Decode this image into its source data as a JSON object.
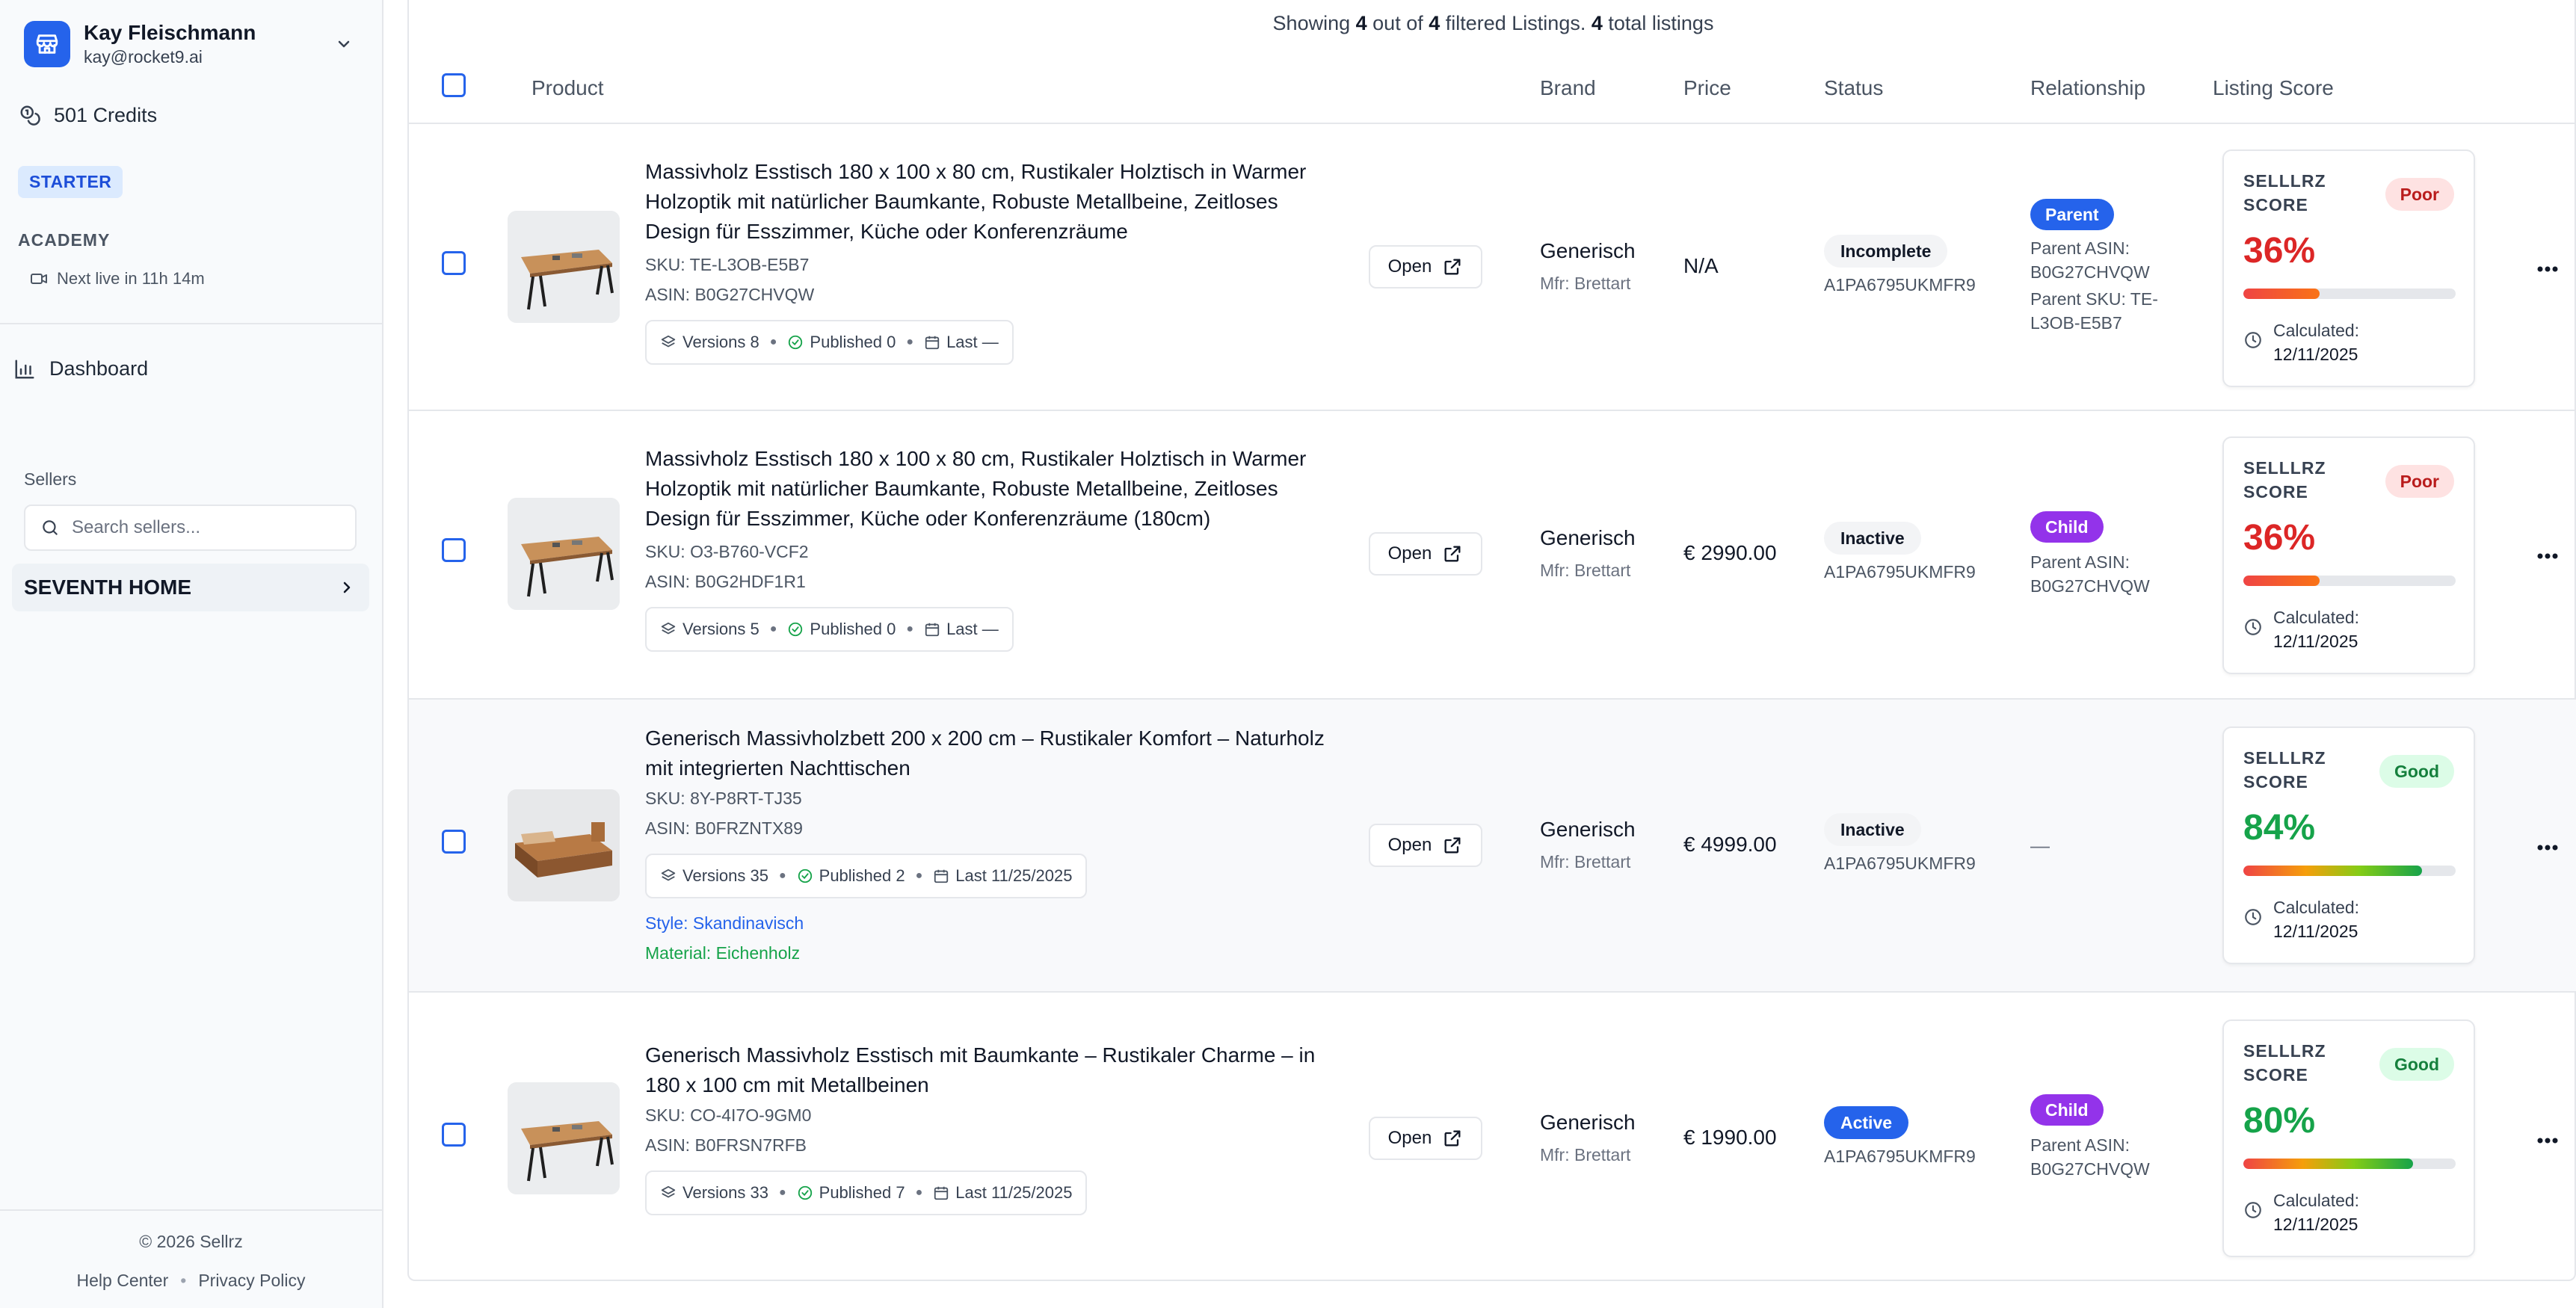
{
  "account": {
    "name": "Kay Fleischmann",
    "email": "kay@rocket9.ai"
  },
  "credits": "501 Credits",
  "plan": "STARTER",
  "academy": {
    "label": "ACADEMY",
    "next_live": "Next live in 11h 14m"
  },
  "nav": {
    "dashboard": "Dashboard"
  },
  "sellers": {
    "label": "Sellers",
    "search_placeholder": "Search sellers...",
    "items": [
      {
        "name": "SEVENTH HOME"
      }
    ]
  },
  "footer": {
    "copyright": "© 2026 Sellrz",
    "help": "Help Center",
    "privacy": "Privacy Policy",
    "separator": "•"
  },
  "summary": {
    "prefix": "Showing ",
    "shown": "4",
    "middle": " out of ",
    "filtered": "4",
    "middle2": " filtered Listings. ",
    "total": "4",
    "suffix": " total listings"
  },
  "columns": {
    "product": "Product",
    "brand": "Brand",
    "price": "Price",
    "status": "Status",
    "relationship": "Relationship",
    "score": "Listing Score"
  },
  "open_label": "Open",
  "score_title": "SELLLRZ SCORE",
  "calc_label": "Calculated:",
  "rows": [
    {
      "title": "Massivholz Esstisch 180 x 100 x 80 cm, Rustikaler Holztisch in Warmer Holzoptik mit natürlicher Baumkante, Robuste Metallbeine, Zeitloses Design für Esszimmer, Küche oder Konferenzräume",
      "sku": "SKU: TE-L3OB-E5B7",
      "asin": "ASIN: B0G27CHVQW",
      "versions": "Versions 8",
      "published": "Published 0",
      "last": "Last —",
      "brand": "Generisch",
      "mfr": "Mfr: Brettart",
      "price": "N/A",
      "status": "Incomplete",
      "seller_id": "A1PA6795UKMFR9",
      "rel": "Parent",
      "rel_info_1": "Parent ASIN: B0G27CHVQW",
      "rel_info_2": "Parent SKU: TE-L3OB-E5B7",
      "score": "36%",
      "score_value": 0.36,
      "badge": "Poor",
      "calc_date": "12/11/2025"
    },
    {
      "title": "Massivholz Esstisch 180 x 100 x 80 cm, Rustikaler Holztisch in Warmer Holzoptik mit natürlicher Baumkante, Robuste Metallbeine, Zeitloses Design für Esszimmer, Küche oder Konferenzräume (180cm)",
      "sku": "SKU: O3-B760-VCF2",
      "asin": "ASIN: B0G2HDF1R1",
      "versions": "Versions 5",
      "published": "Published 0",
      "last": "Last —",
      "brand": "Generisch",
      "mfr": "Mfr: Brettart",
      "price": "€ 2990.00",
      "status": "Inactive",
      "seller_id": "A1PA6795UKMFR9",
      "rel": "Child",
      "rel_info_1": "Parent ASIN: B0G27CHVQW",
      "score": "36%",
      "score_value": 0.36,
      "badge": "Poor",
      "calc_date": "12/11/2025"
    },
    {
      "title": "Generisch Massivholzbett 200 x 200 cm – Rustikaler Komfort – Naturholz mit integrierten Nachttischen",
      "sku": "SKU: 8Y-P8RT-TJ35",
      "asin": "ASIN: B0FRZNTX89",
      "versions": "Versions 35",
      "published": "Published 2",
      "last": "Last 11/25/2025",
      "style": "Style: Skandinavisch",
      "material": "Material: Eichenholz",
      "brand": "Generisch",
      "mfr": "Mfr: Brettart",
      "price": "€ 4999.00",
      "status": "Inactive",
      "seller_id": "A1PA6795UKMFR9",
      "rel_none": "—",
      "score": "84%",
      "score_value": 0.84,
      "badge": "Good",
      "calc_date": "12/11/2025"
    },
    {
      "title": "Generisch Massivholz Esstisch mit Baumkante – Rustikaler Charme – in 180 x 100 cm mit Metallbeinen",
      "sku": "SKU: CO-4I7O-9GM0",
      "asin": "ASIN: B0FRSN7RFB",
      "versions": "Versions 33",
      "published": "Published 7",
      "last": "Last 11/25/2025",
      "brand": "Generisch",
      "mfr": "Mfr: Brettart",
      "price": "€ 1990.00",
      "status": "Active",
      "seller_id": "A1PA6795UKMFR9",
      "rel": "Child",
      "rel_info_1": "Parent ASIN: B0G27CHVQW",
      "score": "80%",
      "score_value": 0.8,
      "badge": "Good",
      "calc_date": "12/11/2025"
    }
  ]
}
